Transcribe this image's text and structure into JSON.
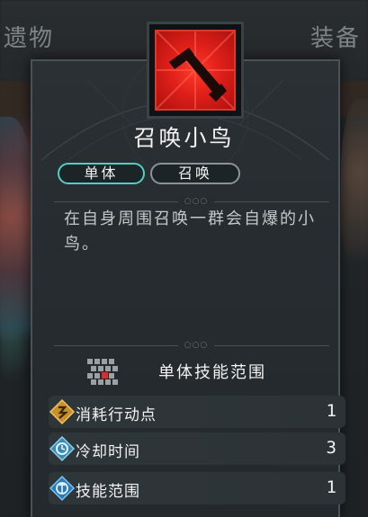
{
  "background": {
    "tab_left": "遗物",
    "tab_right": "装备"
  },
  "skill": {
    "icon": "dagger-icon",
    "icon_color": "#e0201a",
    "title": "召唤小鸟",
    "tags": [
      "单体",
      "召唤"
    ],
    "tag_colors": [
      "#4fd0c4",
      "#8a9498"
    ],
    "description": "在自身周围召唤一群会自爆的小鸟。"
  },
  "range": {
    "icon": "range-grid-icon",
    "label": "单体技能范围"
  },
  "stats": [
    {
      "icon": "action-point-icon",
      "label": "消耗行动点",
      "value": "1"
    },
    {
      "icon": "cooldown-icon",
      "label": "冷却时间",
      "value": "3"
    },
    {
      "icon": "skill-range-icon",
      "label": "技能范围",
      "value": "1"
    }
  ]
}
